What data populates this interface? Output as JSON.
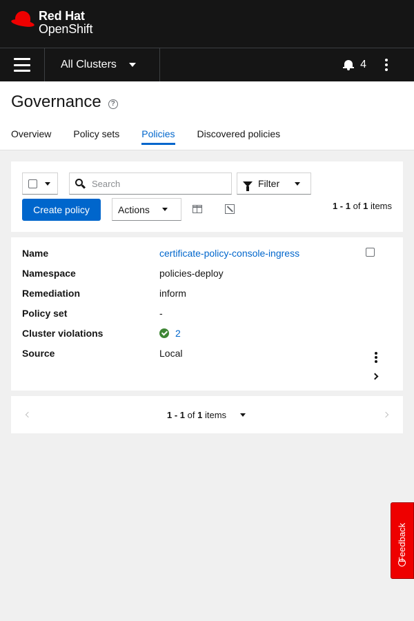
{
  "brand": {
    "line1": "Red Hat",
    "line2": "OpenShift"
  },
  "topbar": {
    "cluster_selector": "All Clusters",
    "notifications_count": "4"
  },
  "page": {
    "title": "Governance",
    "tabs": [
      {
        "label": "Overview",
        "active": false
      },
      {
        "label": "Policy sets",
        "active": false
      },
      {
        "label": "Policies",
        "active": true
      },
      {
        "label": "Discovered policies",
        "active": false
      }
    ]
  },
  "toolbar": {
    "search_placeholder": "Search",
    "filter_label": "Filter",
    "create_label": "Create policy",
    "actions_label": "Actions",
    "count": {
      "range": "1 - 1",
      "of": "of",
      "total": "1",
      "unit": "items"
    }
  },
  "policy": {
    "fields": [
      {
        "key": "Name",
        "value": "certificate-policy-console-ingress",
        "link": true
      },
      {
        "key": "Namespace",
        "value": "policies-deploy"
      },
      {
        "key": "Remediation",
        "value": "inform"
      },
      {
        "key": "Policy set",
        "value": "-"
      },
      {
        "key": "Cluster violations",
        "value": "2",
        "link": true,
        "status": "ok"
      },
      {
        "key": "Source",
        "value": "Local"
      }
    ]
  },
  "pagination": {
    "range": "1 - 1",
    "of": "of",
    "total": "1",
    "unit": "items"
  },
  "feedback": {
    "label": "Feedback"
  },
  "colors": {
    "accent": "#0066cc",
    "brand_red": "#ee0000",
    "success": "#3e8635",
    "masthead": "#151515"
  },
  "icons": [
    "hamburger-icon",
    "bell-icon",
    "kebab-icon",
    "help-icon",
    "search-icon",
    "filter-icon",
    "columns-icon",
    "export-icon",
    "check-circle-icon",
    "chevron-right-icon",
    "chevron-left-icon",
    "feedback-icon"
  ]
}
